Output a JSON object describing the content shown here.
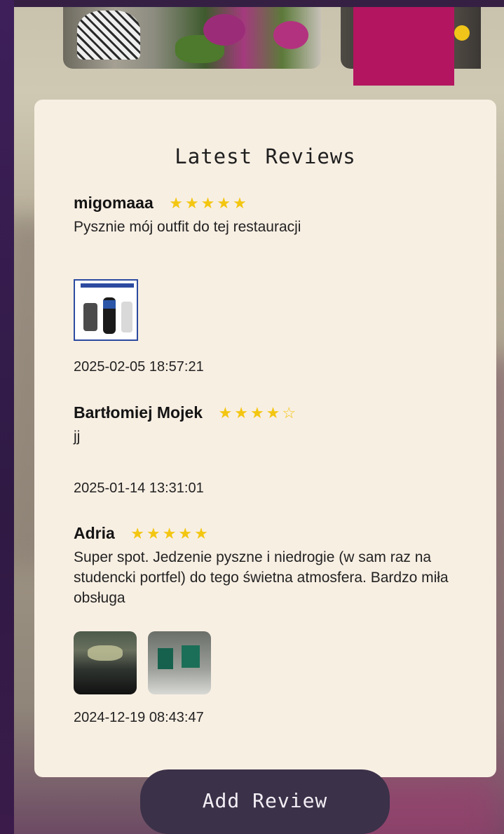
{
  "section_title": "Latest Reviews",
  "reviews": [
    {
      "name": "migomaaa",
      "stars": "★★★★★",
      "rating": 5,
      "text": "Pysznie mój outfit do tej restauracji",
      "date": "2025-02-05 18:57:21",
      "attachments": [
        "outfit-collage"
      ]
    },
    {
      "name": "Bartłomiej Mojek",
      "stars": "★★★★☆",
      "rating": 4,
      "text": "jj",
      "date": "2025-01-14 13:31:01",
      "attachments": []
    },
    {
      "name": "Adria",
      "stars": "★★★★★",
      "rating": 5,
      "text": "Super spot. Jedzenie pyszne i niedrogie (w sam raz na studencki portfel) do tego świetna atmosfera. Bardzo miła obsługa",
      "date": "2024-12-19 08:43:47",
      "attachments": [
        "restaurant-photo",
        "wall-photo"
      ]
    }
  ],
  "add_review_label": "Add Review",
  "colors": {
    "card": "#f8efe3",
    "star": "#f3c611",
    "button": "#3b3149",
    "accent_block": "#b31560"
  }
}
